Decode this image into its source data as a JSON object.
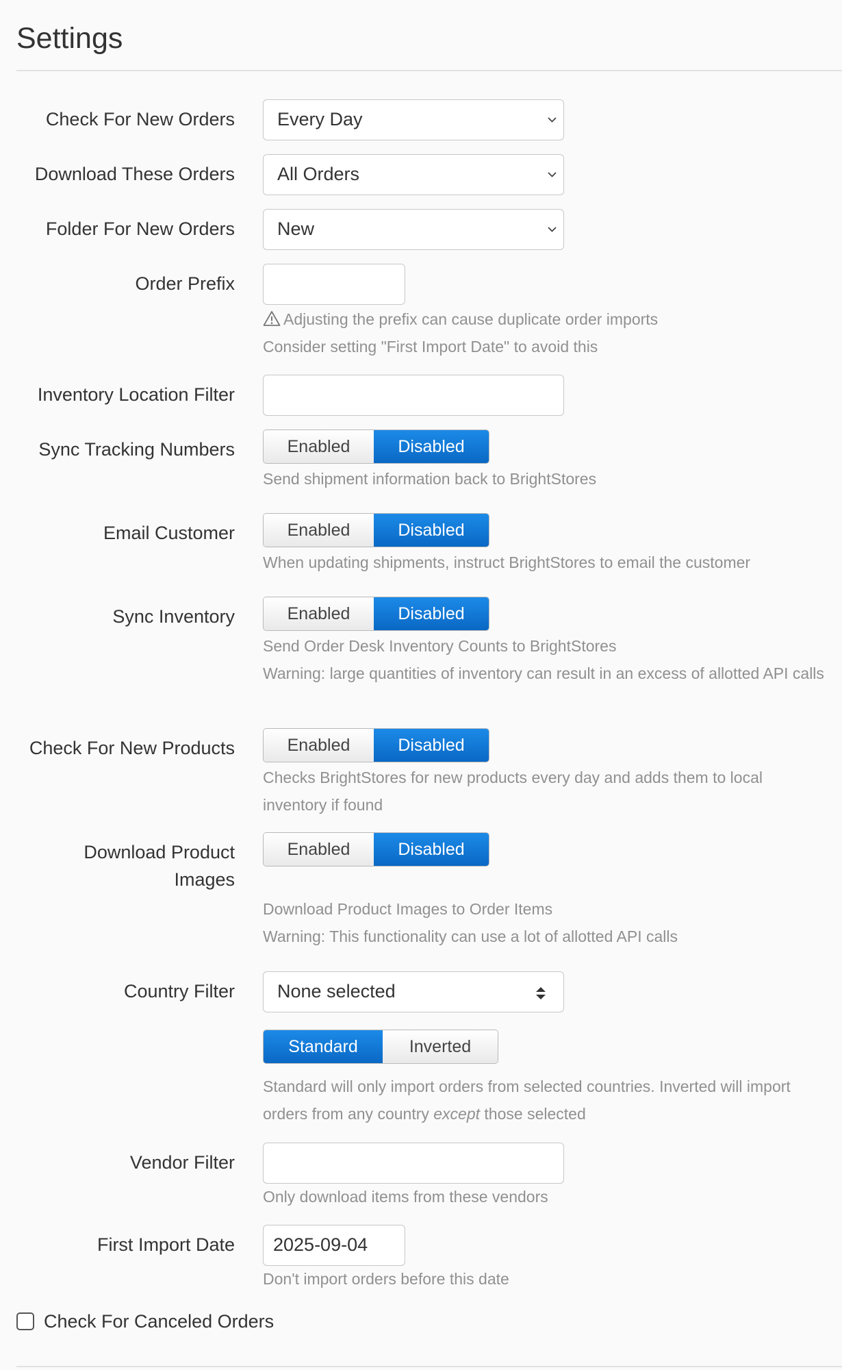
{
  "page": {
    "title": "Settings"
  },
  "fields": {
    "check_new_orders": {
      "label": "Check For New Orders",
      "value": "Every Day"
    },
    "download_orders": {
      "label": "Download These Orders",
      "value": "All Orders"
    },
    "folder_new_orders": {
      "label": "Folder For New Orders",
      "value": "New"
    },
    "order_prefix": {
      "label": "Order Prefix",
      "value": "",
      "help1": "Adjusting the prefix can cause duplicate order imports",
      "help2": "Consider setting \"First Import Date\" to avoid this"
    },
    "inventory_location_filter": {
      "label": "Inventory Location Filter",
      "value": ""
    },
    "sync_tracking": {
      "label": "Sync Tracking Numbers",
      "enabled": "Enabled",
      "disabled": "Disabled",
      "selected": "Disabled",
      "help1": "Send shipment information back to BrightStores"
    },
    "email_customer": {
      "label": "Email Customer",
      "enabled": "Enabled",
      "disabled": "Disabled",
      "selected": "Disabled",
      "help1": "When updating shipments, instruct BrightStores to email the customer"
    },
    "sync_inventory": {
      "label": "Sync Inventory",
      "enabled": "Enabled",
      "disabled": "Disabled",
      "selected": "Disabled",
      "help1": "Send Order Desk Inventory Counts to BrightStores",
      "help2": "Warning: large quantities of inventory can result in an excess of allotted API calls"
    },
    "check_new_products": {
      "label": "Check For New Products",
      "enabled": "Enabled",
      "disabled": "Disabled",
      "selected": "Disabled",
      "help1": "Checks BrightStores for new products every day and adds them to local inventory if found"
    },
    "download_images": {
      "label_line1": "Download Product",
      "label_line2": "Images",
      "enabled": "Enabled",
      "disabled": "Disabled",
      "selected": "Disabled",
      "help1": "Download Product Images to Order Items",
      "help2": "Warning: This functionality can use a lot of allotted API calls"
    },
    "country_filter": {
      "label": "Country Filter",
      "value": "None selected",
      "standard": "Standard",
      "inverted": "Inverted",
      "selected": "Standard",
      "help_pre": "Standard will only import orders from selected countries. Inverted will import orders from any country ",
      "help_em": "except",
      "help_post": " those selected"
    },
    "vendor_filter": {
      "label": "Vendor Filter",
      "value": "",
      "help1": "Only download items from these vendors"
    },
    "first_import_date": {
      "label": "First Import Date",
      "value": "2025-09-04",
      "help1": "Don't import orders before this date"
    },
    "check_canceled": {
      "label": "Check For Canceled Orders",
      "checked": false
    }
  },
  "colors": {
    "accent": "#0a73d2",
    "help_text": "#909090",
    "label_text": "#333333"
  },
  "icons": {
    "select_arrow": "chevron-down-icon",
    "multiselect_arrow": "sort-arrows-icon",
    "warning": "warning-triangle-icon"
  }
}
